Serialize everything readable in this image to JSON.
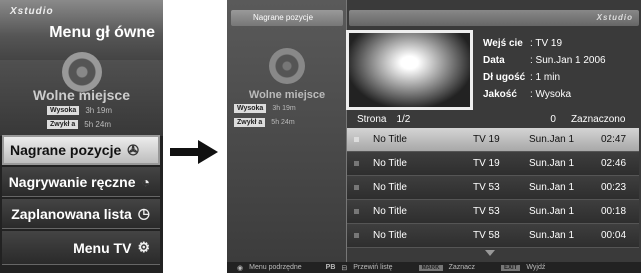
{
  "left_menu": {
    "logo": "Xstudio",
    "title": "Menu gł  ówne",
    "free_space_label": "Wolne miejsce",
    "quality": [
      {
        "label": "Wysoka",
        "time": "3h  19m"
      },
      {
        "label": "Zwykł a",
        "time": "5h  24m"
      }
    ],
    "items": [
      {
        "label": "Nagrane pozycje",
        "icon": "film-reel-icon"
      },
      {
        "label": "Nagrywanie ręczne",
        "icon": "clock-record-icon"
      },
      {
        "label": "Zaplanowana lista",
        "icon": "schedule-clock-icon"
      },
      {
        "label": "Menu TV",
        "icon": "gear-icon"
      }
    ]
  },
  "right_panel": {
    "header": "Nagrane pozycje",
    "logo": "Xstudio",
    "side": {
      "free_space_label": "Wolne miejsce",
      "quality": [
        {
          "label": "Wysoka",
          "time": "3h  19m"
        },
        {
          "label": "Zwykł a",
          "time": "5h  24m"
        }
      ]
    },
    "info": {
      "input_label": "Wejś cie",
      "input_value": ": TV 19",
      "date_label": "Data",
      "date_value": ": Sun.Jan 1 2006",
      "length_label": "Dł ugość",
      "length_value": ": 1 min",
      "quality_label": "Jakość",
      "quality_value": ": Wysoka"
    },
    "page_label": "Strona",
    "page_value": "1/2",
    "selected_count": "0",
    "selected_label": "Zaznaczono",
    "rows": [
      {
        "title": "No Title",
        "channel": "TV 19",
        "date": "Sun.Jan 1",
        "time": "02:47"
      },
      {
        "title": "No Title",
        "channel": "TV 19",
        "date": "Sun.Jan 1",
        "time": "02:46"
      },
      {
        "title": "No Title",
        "channel": "TV 53",
        "date": "Sun.Jan 1",
        "time": "00:23"
      },
      {
        "title": "No Title",
        "channel": "TV 53",
        "date": "Sun.Jan 1",
        "time": "00:18"
      },
      {
        "title": "No Title",
        "channel": "TV 58",
        "date": "Sun.Jan 1",
        "time": "00:04"
      }
    ],
    "footer": {
      "menu_label": "Menu podrzędne",
      "pb_key": "PB",
      "scroll_label": "Przewiń listę",
      "mark_key": "MARK",
      "mark_label": "Zaznacz",
      "exit_key": "EXIT",
      "exit_label": "Wyjdź"
    }
  }
}
